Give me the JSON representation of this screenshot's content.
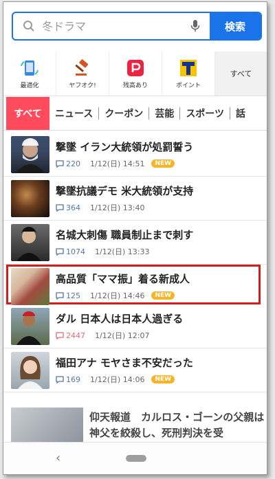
{
  "search": {
    "placeholder": "冬ドラマ",
    "button_label": "検索"
  },
  "shortcuts": [
    {
      "label": "最適化",
      "icon": "optimize-icon"
    },
    {
      "label": "ヤフオク!",
      "icon": "auction-gavel-icon"
    },
    {
      "label": "残高あり",
      "icon": "paypay-icon"
    },
    {
      "label": "ポイント",
      "icon": "tpoint-icon"
    }
  ],
  "shortcuts_more": "すべて",
  "tabs": [
    "すべて",
    "ニュース",
    "クーポン",
    "芸能",
    "スポーツ",
    "話"
  ],
  "news": [
    {
      "headline": "撃墜 イラン大統領が処罰誓う",
      "comments": "220",
      "date": "1/12(日) 14:51",
      "new": "NEW"
    },
    {
      "headline": "撃墜抗議デモ 米大統領が支持",
      "comments": "364",
      "date": "1/12(日) 13:40",
      "new": ""
    },
    {
      "headline": "名城大刺傷 職員制止まで刺す",
      "comments": "1074",
      "date": "1/12(日) 13:33",
      "new": ""
    },
    {
      "headline": "高品質「ママ振」着る新成人",
      "comments": "125",
      "date": "1/12(日) 14:46",
      "new": "NEW"
    },
    {
      "headline": "ダル 日本人は日本人過ぎる",
      "comments": "2447",
      "date": "1/12(日) 12:07",
      "new": ""
    },
    {
      "headline": "福田アナ モヤさま不安だった",
      "comments": "169",
      "date": "1/12(日) 14:06",
      "new": "NEW"
    }
  ],
  "feature": {
    "text": "仰天報道　カルロス・ゴーンの父親は神父を絞殺し、死刑判決を受"
  },
  "colors": {
    "accent_blue": "#1a73e8",
    "active_tab": "#ff4b5c",
    "highlight_border": "#d21d1d",
    "new_badge": "#f6b42a"
  }
}
